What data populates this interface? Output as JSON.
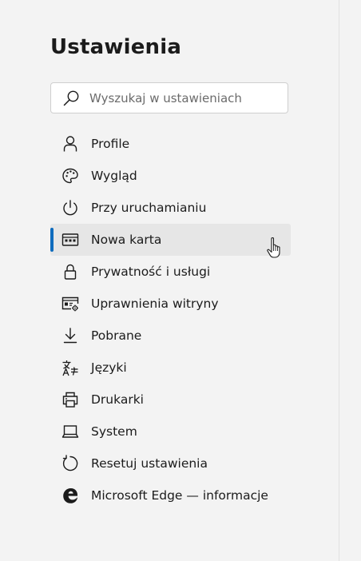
{
  "settings": {
    "title": "Ustawienia",
    "search": {
      "placeholder": "Wyszukaj w ustawieniach",
      "value": ""
    },
    "accent_color": "#0f6cbd",
    "selected_item": "Nowa karta",
    "nav": [
      {
        "label": "Profile",
        "icon": "person-icon"
      },
      {
        "label": "Wygląd",
        "icon": "palette-icon"
      },
      {
        "label": "Przy uruchamianiu",
        "icon": "power-icon"
      },
      {
        "label": "Nowa karta",
        "icon": "new-tab-icon"
      },
      {
        "label": "Prywatność i usługi",
        "icon": "lock-icon"
      },
      {
        "label": "Uprawnienia witryny",
        "icon": "site-permissions-icon"
      },
      {
        "label": "Pobrane",
        "icon": "download-icon"
      },
      {
        "label": "Języki",
        "icon": "languages-icon"
      },
      {
        "label": "Drukarki",
        "icon": "printer-icon"
      },
      {
        "label": "System",
        "icon": "laptop-icon"
      },
      {
        "label": "Resetuj ustawienia",
        "icon": "reset-icon"
      },
      {
        "label": "Microsoft Edge — informacje",
        "icon": "edge-logo-icon"
      }
    ]
  }
}
